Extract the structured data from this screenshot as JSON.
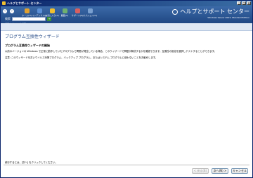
{
  "window": {
    "title": "ヘルプとサポート センター"
  },
  "toolbar": {
    "back_icon": "back-arrow-icon",
    "forward_icon": "forward-arrow-icon",
    "items": [
      {
        "label": "ホーム(H)",
        "icon": "home-icon",
        "color": "#e0a030"
      },
      {
        "label": "インデックス(I)",
        "icon": "index-icon",
        "color": "#5b8fd6"
      },
      {
        "label": "お気に入り(A)",
        "icon": "favorites-icon",
        "color": "#f0c030"
      },
      {
        "label": "履歴(C)",
        "icon": "history-icon",
        "color": "#6fb06f"
      },
      {
        "label": "サポート(S)",
        "icon": "support-icon",
        "color": "#d86060"
      },
      {
        "label": "オプション(O)",
        "icon": "options-icon",
        "color": "#7aa0d0"
      }
    ],
    "brand_title": "ヘルプとサポート センター",
    "brand_subtitle": "Windows Server 2003, Standard Edition"
  },
  "search": {
    "label": "検索",
    "value": "",
    "go": "→",
    "options": "検索オプションの設定"
  },
  "content": {
    "title": "プログラム互換性ウィザード",
    "subtitle": "プログラム互換性ウィザードの開始",
    "paragraph1": "以前のバージョンの Windows で正常に動作していたプログラムで問題が発生している場合、このウィザードで問題が解決するかを確認できます。互換性の設定を選択しテストすることができます。",
    "paragraph2": "注意: このウィザードを古いウイルス対策プログラム、バックアップ プログラム、またはシステム プログラムに使わないことをお勧めします。",
    "footer": "続行するには、[次へ] をクリックしてください。"
  },
  "buttons": {
    "back": "< 戻る(B)",
    "next": "次へ(N) >",
    "cancel": "キャンセル"
  }
}
